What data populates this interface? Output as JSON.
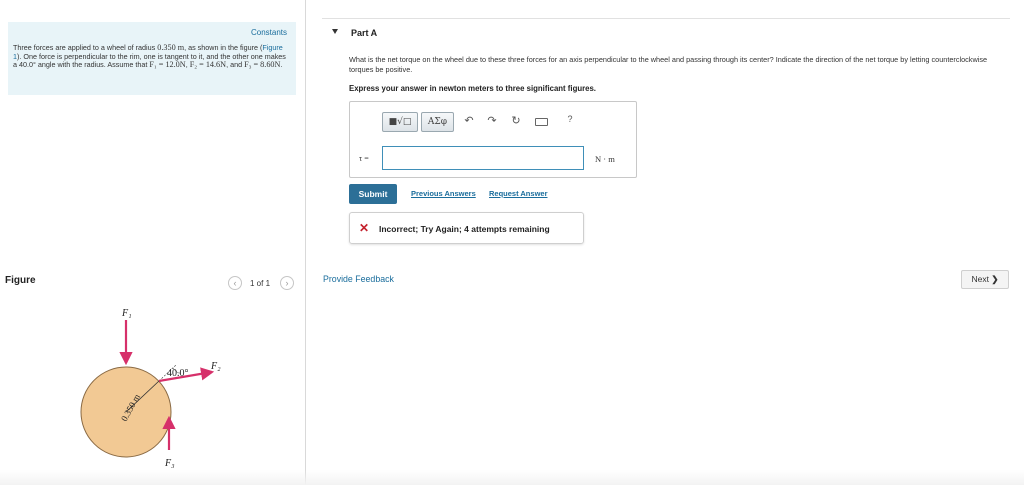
{
  "problem": {
    "constants_link": "Constants",
    "text_1": "Three forces are applied to a wheel of radius ",
    "radius": "0.350 m",
    "text_2": ", as shown in the figure (",
    "figure_link": "Figure 1",
    "text_3": "). One force is perpendicular to the rim, one is tangent to it, and the other one makes a 40.0° angle with the radius. Assume that ",
    "f1_eq": "F₁ = 12.0N",
    "sep_1": ", ",
    "f2_eq": "F₂ = 14.6N",
    "sep_2": ", and ",
    "f3_eq": "F₃ = 8.60N",
    "end": "."
  },
  "figure": {
    "title": "Figure",
    "count": "1 of 1",
    "prev_icon": "‹",
    "next_icon": "›",
    "labels": {
      "f1": "F₁",
      "f2": "F₂",
      "f3": "F₃",
      "angle": "40.0°",
      "radius": "0.350 m"
    },
    "colors": {
      "wheel": "#f2c994",
      "wheel_stroke": "#8a6a44",
      "arrow": "#d6306a"
    }
  },
  "part": {
    "title": "Part A",
    "question": "What is the net torque on the wheel due to these three forces for an axis perpendicular to the wheel and passing through its center? Indicate the direction of the net torque by letting counterclockwise torques be positive.",
    "instruction": "Express your answer in newton meters to three significant figures."
  },
  "answer": {
    "toolbar": {
      "templates_label": "■√□",
      "greek_label": "ΑΣφ",
      "undo_icon": "↶",
      "redo_icon": "↷",
      "reset_icon": "↻",
      "help_label": "?"
    },
    "variable_label": "τ =",
    "value": "",
    "placeholder": "",
    "unit": "N · m"
  },
  "actions": {
    "submit": "Submit",
    "previous_answers": "Previous Answers",
    "request_answer": "Request Answer"
  },
  "feedback": {
    "icon": "✕",
    "message": "Incorrect; Try Again; 4 attempts remaining"
  },
  "footer": {
    "provide_feedback": "Provide Feedback",
    "next_label": "Next",
    "next_icon": "❯"
  }
}
